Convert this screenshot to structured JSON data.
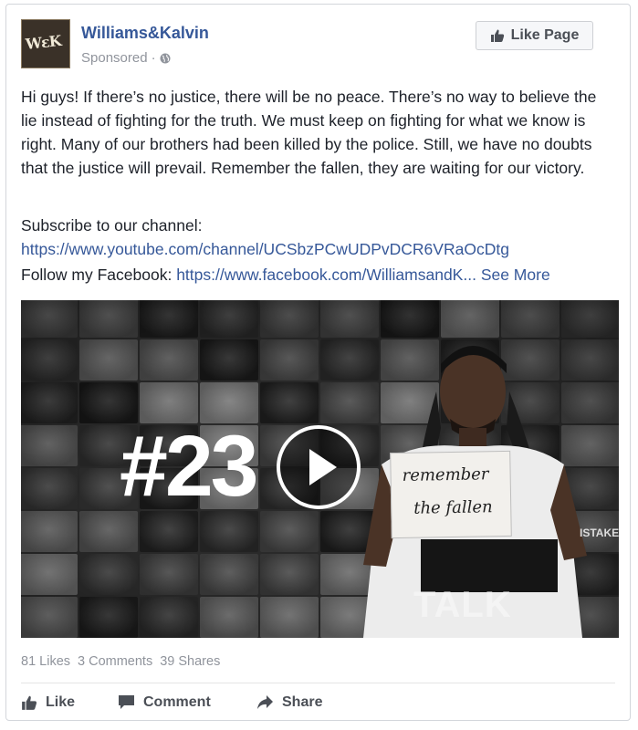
{
  "post": {
    "page_name": "Williams&Kalvin",
    "logo_text": "WεK",
    "sponsored_label": "Sponsored",
    "separator": "·",
    "like_page_label": "Like Page",
    "body_text": "Hi guys! If there’s no justice, there will be no peace. There’s no way to believe the lie instead of fighting for the truth. We must keep on fighting for what we know is right. Many of our brothers had been killed by the police. Still, we have no doubts that the justice will prevail. Remember the fallen, they are waiting for our victory.",
    "subscribe_label": "Subscribe to our channel:",
    "subscribe_url": "https://www.youtube.com/channel/UCSbzPCwUDPvDCR6VRaOcDtg",
    "follow_label": "Follow my Facebook: ",
    "follow_url": "https://www.facebook.com/WilliamsandK...",
    "see_more": "See More"
  },
  "video": {
    "hashtag_text": "#23",
    "sign_line1": "remember",
    "sign_line2": "the fallen",
    "shirt_text": "TALK",
    "edge_text": "ISTAKE"
  },
  "stats": {
    "likes": "81 Likes",
    "comments": "3 Comments",
    "shares": "39 Shares"
  },
  "actions": {
    "like": "Like",
    "comment": "Comment",
    "share": "Share"
  },
  "colors": {
    "link": "#365899",
    "muted": "#90949c",
    "text": "#1d2129",
    "action_text": "#4b4f56"
  },
  "icons": {
    "globe": "globe-icon",
    "thumbs_up": "thumbs-up-icon",
    "comment": "comment-icon",
    "share": "share-icon",
    "play": "play-icon"
  }
}
